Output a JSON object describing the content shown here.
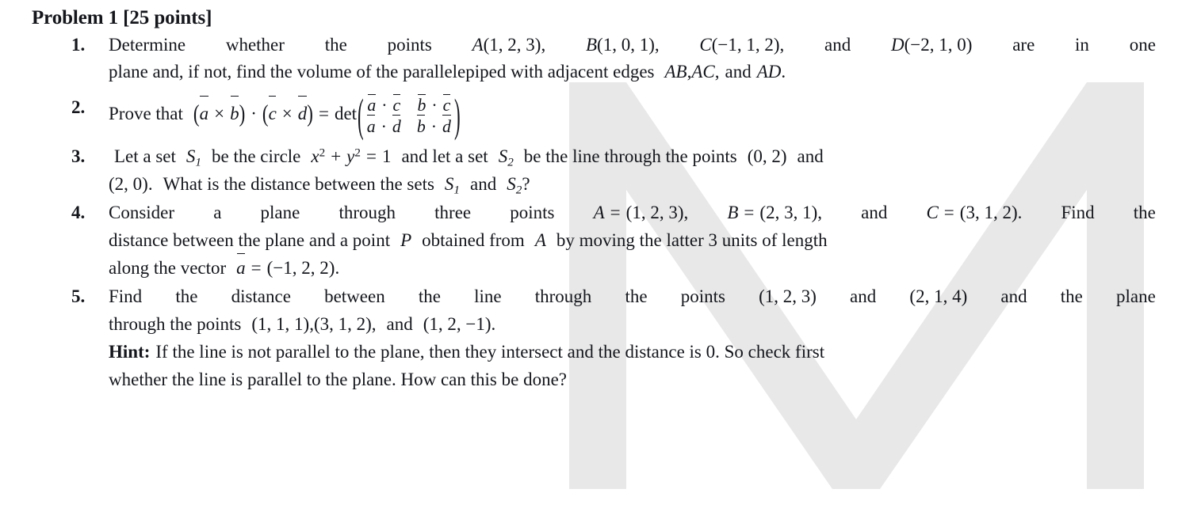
{
  "document": {
    "title": "Problem 1 [25 points]",
    "watermark": {
      "letter": "M",
      "color": "#e8e8e8"
    },
    "text_color": "#14161c",
    "background_color": "#ffffff"
  },
  "items": [
    {
      "number": "1.",
      "lines": [
        {
          "id": "i1l1",
          "segments": [
            "Determine",
            "whether",
            "the",
            "points",
            "A(1, 2, 3),",
            "B(1, 0, 1),",
            "C(−1, 1, 2),",
            "and",
            "D(−2, 1, 0)",
            "are",
            "in",
            "one"
          ],
          "plain": "Determine whether the points A(1, 2, 3), B(1, 0, 1), C(−1, 1, 2), and D(−2, 1, 0) are in one"
        },
        {
          "id": "i1l2",
          "plain": "plane and, if not, find the volume of the parallelepiped with adjacent edges AB, AC, and AD."
        }
      ]
    },
    {
      "number": "2.",
      "lines": [
        {
          "id": "i2l1",
          "plain": "Prove that (ā × b̄) · (c̄ × d̄) = det (ā·c̄  b̄·c̄ ; ā·d̄  b̄·d̄)"
        }
      ],
      "prove_label": "Prove that",
      "det_label": "det",
      "matrix": [
        [
          "ā · c̄",
          "b̄ · c̄"
        ],
        [
          "ā · d̄",
          "b̄ · d̄"
        ]
      ]
    },
    {
      "number": "3.",
      "lines": [
        {
          "id": "i3l1",
          "plain": "Let a set S₁ be the circle x² + y² = 1 and let a set S₂ be the line through the points (0, 2) and"
        },
        {
          "id": "i3l2",
          "plain": "(2, 0). What is the distance between the sets S₁ and S₂?"
        }
      ]
    },
    {
      "number": "4.",
      "lines": [
        {
          "id": "i4l1",
          "plain": "Consider a plane through three points A = (1, 2, 3), B = (2, 3, 1), and C = (3, 1, 2). Find the"
        },
        {
          "id": "i4l2",
          "plain": "distance between the plane and a point P obtained from A by moving the latter 3 units of length"
        },
        {
          "id": "i4l3",
          "plain": "along the vector ā = (−1, 2, 2)."
        }
      ]
    },
    {
      "number": "5.",
      "lines": [
        {
          "id": "i5l1",
          "plain": "Find the distance between the line through the points (1, 2, 3) and (2, 1, 4) and the plane"
        },
        {
          "id": "i5l2",
          "plain": "through the points (1, 1, 1), (3, 1, 2), and (1, 2, −1)."
        },
        {
          "id": "i5l3",
          "hint_label": "Hint:",
          "plain": "Hint: If the line is not parallel to the plane, then they intersect and the distance is 0. So check first"
        },
        {
          "id": "i5l4",
          "plain": "whether the line is parallel to the plane. How can this be done?"
        }
      ]
    }
  ],
  "tokens": {
    "i1l1": {
      "w1": "Determine",
      "w2": "whether",
      "w3": "the",
      "w4": "points",
      "pA": "A",
      "pAv": "(1, 2, 3),",
      "pB": "B",
      "pBv": "(1, 0, 1),",
      "pC": "C",
      "pCv": "(−1, 1, 2),",
      "and1": "and",
      "pD": "D",
      "pDv": "(−2, 1, 0)",
      "w5": "are",
      "w6": "in",
      "w7": "one"
    },
    "i1l2": {
      "a": "plane and, if not, find the volume of the parallelepiped with adjacent edges",
      "ab": "AB",
      "comma1": ",",
      "ac": "AC",
      "comma2": ",",
      "and": "and",
      "ad": "AD",
      "period": "."
    },
    "i2l1": {
      "prove": "Prove that",
      "lp": "(",
      "a": "a",
      "times1": "×",
      "b": "b",
      "rp": ")",
      "dot": "·",
      "lp2": "(",
      "c": "c",
      "times2": "×",
      "d": "d",
      "rp2": ")",
      "eq": "=",
      "det": "det",
      "m11a": "a",
      "m11dot": "·",
      "m11b": "c",
      "m12a": "b",
      "m12dot": "·",
      "m12b": "c",
      "m21a": "a",
      "m21dot": "·",
      "m21b": "d",
      "m22a": "b",
      "m22dot": "·",
      "m22b": "d"
    },
    "i3l1": {
      "t1": "Let a set",
      "S": "S",
      "s1": "1",
      "t2": "be the circle",
      "x": "x",
      "x2": "2",
      "plus": "+",
      "y": "y",
      "y2": "2",
      "eq": "=",
      "one": "1",
      "t3": "and let a set",
      "S2": "S",
      "s2": "2",
      "t4": "be the line through the points",
      "pt": "(0, 2)",
      "t5": "and"
    },
    "i3l2": {
      "t1": "(2, 0).",
      "t2": "What is the distance between the sets",
      "S1": "S",
      "s1": "1",
      "and": "and",
      "S2": "S",
      "s2": "2",
      "q": "?"
    },
    "i4l1": {
      "t1": "Consider",
      "t2": "a",
      "t3": "plane",
      "t4": "through",
      "t5": "three",
      "t6": "points",
      "A": "A",
      "eq1": "=",
      "Av": "(1, 2, 3),",
      "B": "B",
      "eq2": "=",
      "Bv": "(2, 3, 1),",
      "and": "and",
      "C": "C",
      "eq3": "=",
      "Cv": "(3, 1, 2).",
      "t7": "Find",
      "t8": "the"
    },
    "i4l2": {
      "t1": "distance between the plane and a point",
      "P": "P",
      "t2": "obtained from",
      "A": "A",
      "t3": "by moving the latter 3 units of length"
    },
    "i4l3": {
      "t1": "along the vector",
      "a": "a",
      "eq": "=",
      "v": "(−1, 2, 2)."
    },
    "i5l1": {
      "t1": "Find",
      "t2": "the",
      "t3": "distance",
      "t4": "between",
      "t5": "the",
      "t6": "line",
      "t7": "through",
      "t8": "the",
      "t9": "points",
      "p1": "(1, 2, 3)",
      "and1": "and",
      "p2": "(2, 1, 4)",
      "and2": "and",
      "t10": "the",
      "t11": "plane"
    },
    "i5l2": {
      "t1": "through the points",
      "p1": "(1, 1, 1),",
      "p2": "(3, 1, 2),",
      "and": "and",
      "p3": "(1, 2, −1)."
    },
    "i5l3": {
      "hint": "Hint:",
      "t1": "If the line is not parallel to the plane, then they intersect and the distance is 0. So check first"
    },
    "i5l4": {
      "t1": "whether the line is parallel to the plane. How can this be done?"
    }
  }
}
